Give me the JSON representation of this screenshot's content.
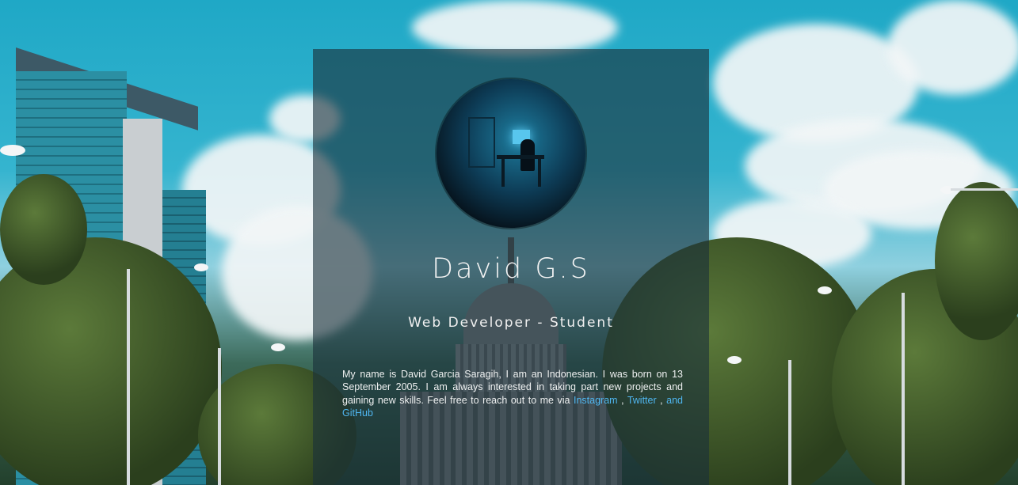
{
  "profile": {
    "name": "David G.S",
    "role": "Web Developer - Student",
    "bio_text": "My name is David Garcia Saragih, I am an Indonesian. I was born on 13 September 2005. I am always interested in taking part new projects and gaining new skills. Feel free to reach out to me via",
    "links": {
      "instagram": "Instagram",
      "sep1": " , ",
      "twitter": "Twitter",
      "sep2": " , ",
      "and_github": "and GitHub"
    }
  },
  "colors": {
    "link": "#4fb6f0",
    "card_overlay": "rgba(26,48,58,0.62)",
    "sky": "#1fa8c6"
  }
}
